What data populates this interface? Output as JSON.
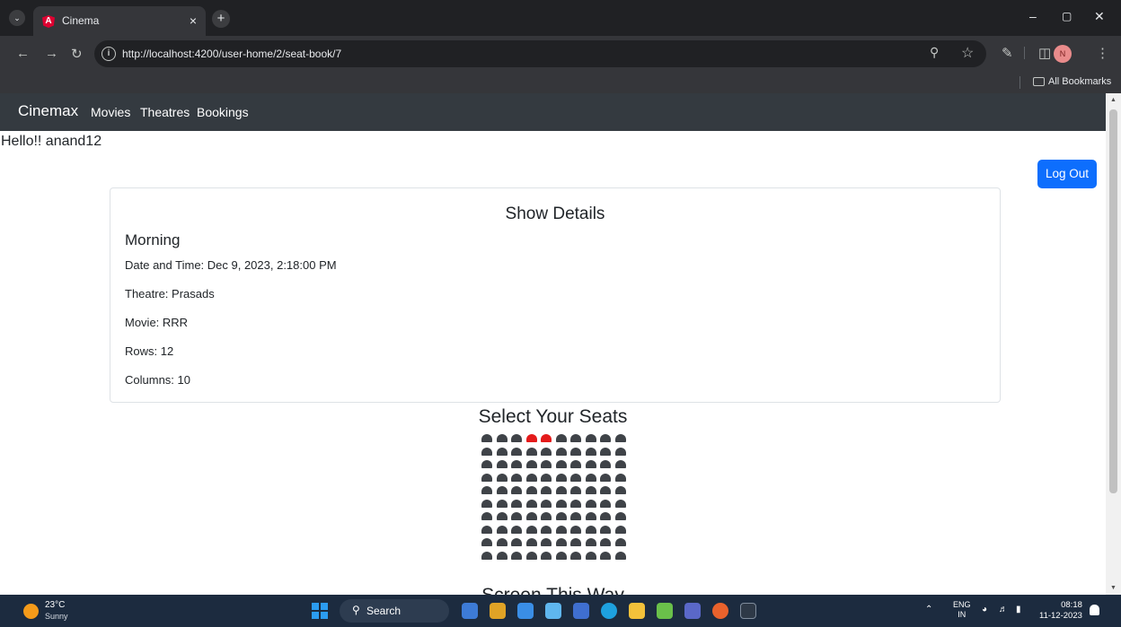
{
  "browser": {
    "tab_title": "Cinema",
    "url": "http://localhost:4200/user-home/2/seat-book/7",
    "bookmarks_label": "All Bookmarks",
    "profile_initial": "N"
  },
  "app": {
    "brand": "Cinemax",
    "nav": [
      "Movies",
      "Theatres",
      "Bookings"
    ],
    "greeting": "Hello!! anand12",
    "logout_label": "Log Out"
  },
  "show_details": {
    "heading": "Show Details",
    "show_name": "Morning",
    "date_time": "Date and Time: Dec 9, 2023, 2:18:00 PM",
    "theatre": "Theatre: Prasads",
    "movie": "Movie: RRR",
    "rows": "Rows: 12",
    "columns": "Columns: 10"
  },
  "seating": {
    "heading": "Select Your Seats",
    "visible_rows": 10,
    "columns": 10,
    "booked": [
      [
        0,
        3
      ],
      [
        0,
        4
      ]
    ],
    "colors": {
      "available": "#3f4348",
      "booked": "#e41b1b"
    },
    "partial_text": "Screen This Way"
  },
  "taskbar": {
    "temperature": "23°C",
    "condition": "Sunny",
    "search_label": "Search",
    "language_top": "ENG",
    "language_bottom": "IN",
    "time": "08:18",
    "date": "11-12-2023"
  },
  "colors": {
    "navbar": "#343a40",
    "primary_button": "#0d6efd"
  }
}
